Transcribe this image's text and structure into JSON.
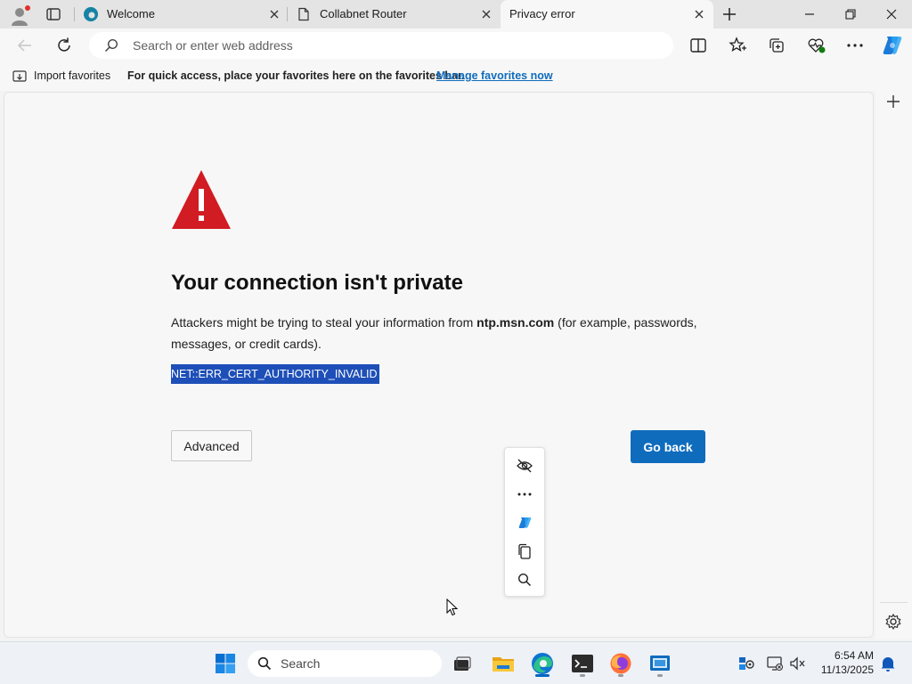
{
  "browser": {
    "tabs": [
      {
        "title": "Welcome",
        "active": false
      },
      {
        "title": "Collabnet Router",
        "active": false
      },
      {
        "title": "Privacy error",
        "active": true
      }
    ],
    "address_placeholder": "Search or enter web address"
  },
  "favorites_bar": {
    "import_label": "Import favorites",
    "hint_text": "For quick access, place your favorites here on the favorites bar.",
    "manage_link": "Manage favorites now"
  },
  "page": {
    "heading": "Your connection isn't private",
    "desc_before": "Attackers might be trying to steal your information from ",
    "desc_domain": "ntp.msn.com",
    "desc_after": " (for example, passwords, messages, or credit cards).",
    "error_code": "NET::ERR_CERT_AUTHORITY_INVALID",
    "advanced_label": "Advanced",
    "go_back_label": "Go back"
  },
  "mini_menu": {
    "icons": [
      "hide-icon",
      "more-icon",
      "copilot-icon",
      "copy-icon",
      "search-icon"
    ]
  },
  "taskbar": {
    "search_placeholder": "Search",
    "time": "6:54 AM",
    "date": "11/13/2025"
  },
  "colors": {
    "accent": "#0f6cbd",
    "warning_red": "#d01c22",
    "selection": "#1e4fb8"
  }
}
